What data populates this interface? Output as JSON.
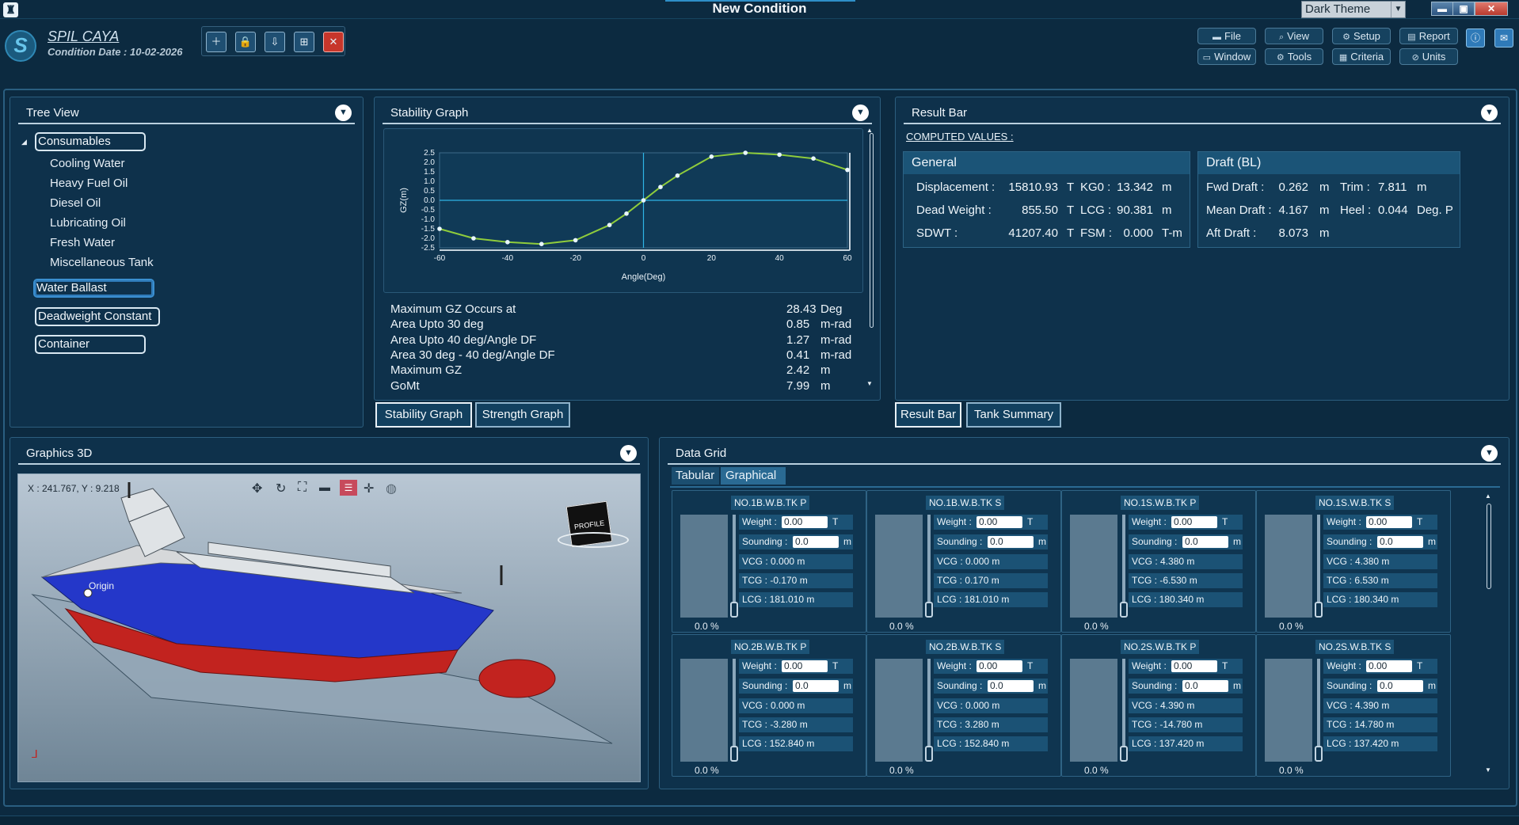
{
  "window": {
    "title": "New Condition",
    "app_icon": "app-logo-icon",
    "theme": "Dark Theme"
  },
  "header": {
    "logo_text": "S",
    "ship_name": "SPIL CAYA",
    "condition_date": "Condition Date : 10-02-2026"
  },
  "menu": {
    "file": "File",
    "view": "View",
    "setup": "Setup",
    "report": "Report",
    "window": "Window",
    "tools": "Tools",
    "criteria": "Criteria",
    "units": "Units"
  },
  "tree": {
    "title": "Tree View",
    "consumables": "Consumables",
    "items": [
      "Cooling Water",
      "Heavy Fuel Oil",
      "Diesel Oil",
      "Lubricating Oil",
      "Fresh Water",
      "Miscellaneous Tank"
    ],
    "water_ballast": "Water Ballast",
    "deadweight": "Deadweight Constant",
    "container": "Container"
  },
  "stability": {
    "title": "Stability Graph",
    "xlabel": "Angle(Deg)",
    "ylabel": "GZ(m)",
    "rows": [
      {
        "label": "Maximum GZ Occurs at",
        "value": "28.43",
        "unit": "Deg"
      },
      {
        "label": "Area Upto 30 deg",
        "value": "0.85",
        "unit": "m-rad"
      },
      {
        "label": "Area Upto 40 deg/Angle DF",
        "value": "1.27",
        "unit": "m-rad"
      },
      {
        "label": "Area 30 deg - 40 deg/Angle DF",
        "value": "0.41",
        "unit": "m-rad"
      },
      {
        "label": "Maximum GZ",
        "value": "2.42",
        "unit": "m"
      },
      {
        "label": "GoMt",
        "value": "7.99",
        "unit": "m"
      }
    ],
    "tab1": "Stability Graph",
    "tab2": "Strength Graph"
  },
  "chart_data": {
    "type": "line",
    "xlabel": "Angle(Deg)",
    "ylabel": "GZ(m)",
    "xlim": [
      -60,
      60
    ],
    "ylim": [
      -2.5,
      2.5
    ],
    "xticks": [
      "-60",
      "-40",
      "-20",
      "0",
      "20",
      "40",
      "60"
    ],
    "yticks": [
      "2.5",
      "2.0",
      "1.5",
      "1.0",
      "0.5",
      "0.0",
      "-0.5",
      "-1.0",
      "-1.5",
      "-2.0",
      "-2.5"
    ],
    "x": [
      -60,
      -50,
      -40,
      -30,
      -20,
      -10,
      -5,
      0,
      5,
      10,
      20,
      30,
      40,
      50,
      60
    ],
    "y": [
      -1.5,
      -2.0,
      -2.2,
      -2.3,
      -2.1,
      -1.3,
      -0.7,
      0.0,
      0.7,
      1.3,
      2.3,
      2.5,
      2.4,
      2.2,
      1.6
    ]
  },
  "result": {
    "title": "Result Bar",
    "computed": "COMPUTED VALUES :",
    "general": "General",
    "draft": "Draft (BL)",
    "displacement_l": "Displacement :",
    "displacement_v": "15810.93",
    "displacement_u": "T",
    "kg0_l": "KG0 :",
    "kg0_v": "13.342",
    "kg0_u": "m",
    "dw_l": "Dead Weight :",
    "dw_v": "855.50",
    "dw_u": "T",
    "lcg_l": "LCG :",
    "lcg_v": "90.381",
    "lcg_u": "m",
    "sdwt_l": "SDWT :",
    "sdwt_v": "41207.40",
    "sdwt_u": "T",
    "fsm_l": "FSM :",
    "fsm_v": "0.000",
    "fsm_u": "T-m",
    "fwd_l": "Fwd Draft :",
    "fwd_v": "0.262",
    "fwd_u": "m",
    "trim_l": "Trim :",
    "trim_v": "7.811",
    "trim_u": "m",
    "mean_l": "Mean Draft :",
    "mean_v": "4.167",
    "mean_u": "m",
    "heel_l": "Heel :",
    "heel_v": "0.044",
    "heel_u": "Deg. P",
    "aft_l": "Aft Draft :",
    "aft_v": "8.073",
    "aft_u": "m",
    "tab1": "Result Bar",
    "tab2": "Tank Summary"
  },
  "graphics": {
    "title": "Graphics 3D",
    "coords": "X : 241.767, Y : 9.218",
    "origin": "Origin",
    "cube": "PROFILE"
  },
  "grid": {
    "title": "Data Grid",
    "tab1": "Tabular",
    "tab2": "Graphical",
    "tanks": [
      {
        "name": "NO.1B.W.B.TK  P",
        "weight": "0.00",
        "sounding": "0.0",
        "vcg": "VCG : 0.000 m",
        "tcg": "TCG : -0.170 m",
        "lcg": "LCG : 181.010 m",
        "pct": "0.0 %"
      },
      {
        "name": "NO.1B.W.B.TK  S",
        "weight": "0.00",
        "sounding": "0.0",
        "vcg": "VCG : 0.000 m",
        "tcg": "TCG : 0.170 m",
        "lcg": "LCG : 181.010 m",
        "pct": "0.0 %"
      },
      {
        "name": "NO.1S.W.B.TK  P",
        "weight": "0.00",
        "sounding": "0.0",
        "vcg": "VCG : 4.380 m",
        "tcg": "TCG : -6.530 m",
        "lcg": "LCG : 180.340 m",
        "pct": "0.0 %"
      },
      {
        "name": "NO.1S.W.B.TK  S",
        "weight": "0.00",
        "sounding": "0.0",
        "vcg": "VCG : 4.380 m",
        "tcg": "TCG : 6.530 m",
        "lcg": "LCG : 180.340 m",
        "pct": "0.0 %"
      },
      {
        "name": "NO.2B.W.B.TK  P",
        "weight": "0.00",
        "sounding": "0.0",
        "vcg": "VCG : 0.000 m",
        "tcg": "TCG : -3.280 m",
        "lcg": "LCG : 152.840 m",
        "pct": "0.0 %"
      },
      {
        "name": "NO.2B.W.B.TK  S",
        "weight": "0.00",
        "sounding": "0.0",
        "vcg": "VCG : 0.000 m",
        "tcg": "TCG : 3.280 m",
        "lcg": "LCG : 152.840 m",
        "pct": "0.0 %"
      },
      {
        "name": "NO.2S.W.B.TK  P",
        "weight": "0.00",
        "sounding": "0.0",
        "vcg": "VCG : 4.390 m",
        "tcg": "TCG : -14.780 m",
        "lcg": "LCG : 137.420 m",
        "pct": "0.0 %"
      },
      {
        "name": "NO.2S.W.B.TK  S",
        "weight": "0.00",
        "sounding": "0.0",
        "vcg": "VCG : 4.390 m",
        "tcg": "TCG : 14.780 m",
        "lcg": "LCG : 137.420 m",
        "pct": "0.0 %"
      }
    ],
    "weight_l": "Weight :",
    "sounding_l": "Sounding :",
    "t_unit": "T",
    "m_unit": "m"
  }
}
